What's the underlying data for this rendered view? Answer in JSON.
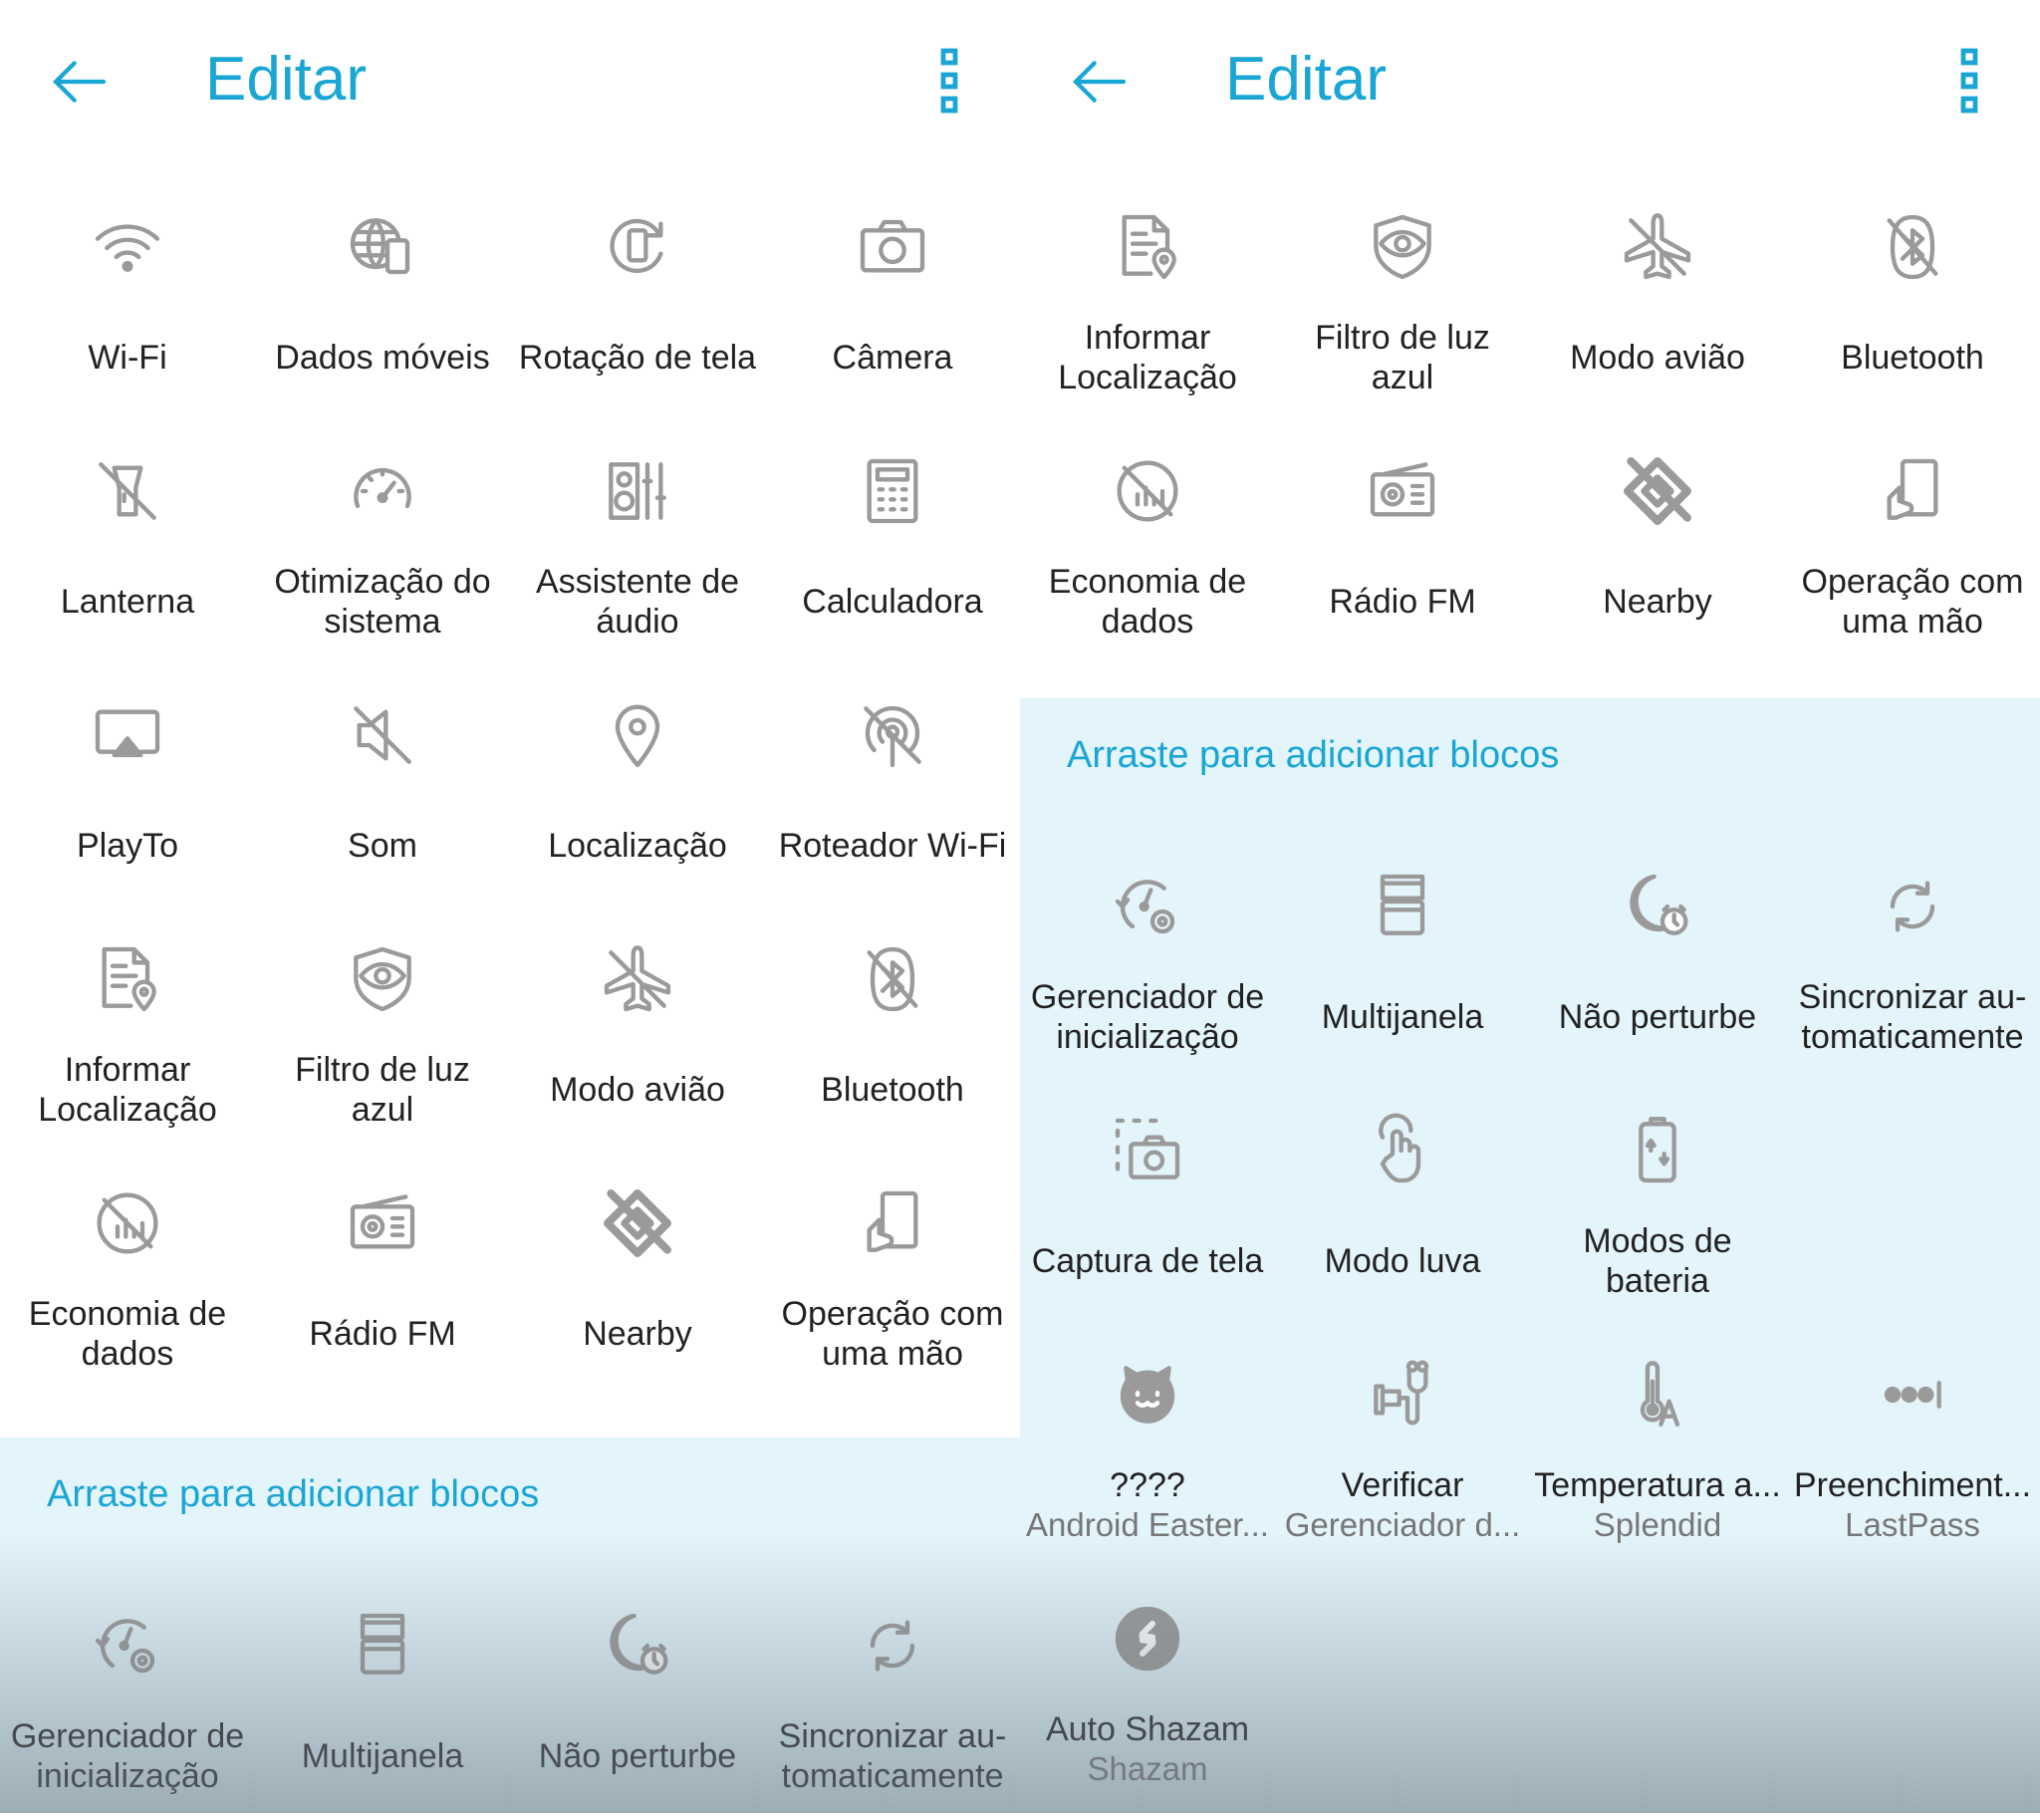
{
  "colors": {
    "accent": "#1aa6d4",
    "icon": "#9a9a9a",
    "drag_area": "#e3f4fb"
  },
  "left": {
    "header": {
      "title": "Editar",
      "back_icon": "arrow-left-icon",
      "menu_icon": "more-vert-icon"
    },
    "active_tiles": [
      {
        "label": "Wi-Fi",
        "icon": "wifi"
      },
      {
        "label": "Dados móveis",
        "icon": "globe-phone"
      },
      {
        "label": "Rotação de tela",
        "icon": "rotate"
      },
      {
        "label": "Câmera",
        "icon": "camera"
      },
      {
        "label": "Lanterna",
        "icon": "flashlight-off"
      },
      {
        "label": "Otimização do\nsistema",
        "icon": "speedometer"
      },
      {
        "label": "Assistente de\náudio",
        "icon": "audio"
      },
      {
        "label": "Calculadora",
        "icon": "calculator"
      },
      {
        "label": "PlayTo",
        "icon": "cast"
      },
      {
        "label": "Som",
        "icon": "sound-off"
      },
      {
        "label": "Localização",
        "icon": "location"
      },
      {
        "label": "Roteador Wi-Fi",
        "icon": "hotspot-off"
      },
      {
        "label": "Informar\nLocalização",
        "icon": "report-location"
      },
      {
        "label": "Filtro de luz\nazul",
        "icon": "eye-shield"
      },
      {
        "label": "Modo avião",
        "icon": "airplane"
      },
      {
        "label": "Bluetooth",
        "icon": "bluetooth-off"
      },
      {
        "label": "Economia de\ndados",
        "icon": "data-saver"
      },
      {
        "label": "Rádio FM",
        "icon": "radio"
      },
      {
        "label": "Nearby",
        "icon": "nearby"
      },
      {
        "label": "Operação com\numa mão",
        "icon": "one-hand"
      }
    ],
    "drag_header": "Arraste para adicionar blocos",
    "available_tiles": [
      {
        "label": "Gerenciador de\ninicialização",
        "icon": "startup"
      },
      {
        "label": "Multijanela",
        "icon": "multiwindow"
      },
      {
        "label": "Não perturbe",
        "icon": "moon-alarm"
      },
      {
        "label": "Sincronizar au-\ntomaticamente",
        "icon": "sync"
      }
    ]
  },
  "right": {
    "header": {
      "title": "Editar",
      "back_icon": "arrow-left-icon",
      "menu_icon": "more-vert-icon"
    },
    "active_tiles": [
      {
        "label": "Informar\nLocalização",
        "icon": "report-location"
      },
      {
        "label": "Filtro de luz\nazul",
        "icon": "eye-shield"
      },
      {
        "label": "Modo avião",
        "icon": "airplane"
      },
      {
        "label": "Bluetooth",
        "icon": "bluetooth-off"
      },
      {
        "label": "Economia de\ndados",
        "icon": "data-saver"
      },
      {
        "label": "Rádio FM",
        "icon": "radio"
      },
      {
        "label": "Nearby",
        "icon": "nearby"
      },
      {
        "label": "Operação com\numa mão",
        "icon": "one-hand"
      }
    ],
    "drag_header": "Arraste para adicionar blocos",
    "available_tiles": [
      {
        "label": "Gerenciador de\ninicialização",
        "icon": "startup"
      },
      {
        "label": "Multijanela",
        "icon": "multiwindow"
      },
      {
        "label": "Não perturbe",
        "icon": "moon-alarm"
      },
      {
        "label": "Sincronizar au-\ntomaticamente",
        "icon": "sync"
      },
      {
        "label": "Captura de tela",
        "icon": "screenshot"
      },
      {
        "label": "Modo luva",
        "icon": "glove"
      },
      {
        "label": "Modos de\nbateria",
        "icon": "battery"
      },
      null,
      {
        "label": "????",
        "sub": "Android Easter...",
        "icon": "cat"
      },
      {
        "label": "Verificar",
        "sub": "Gerenciador d...",
        "icon": "stethoscope"
      },
      {
        "label": "Temperatura a...",
        "sub": "Splendid",
        "icon": "thermometer"
      },
      {
        "label": "Preenchiment...",
        "sub": "LastPass",
        "icon": "lastpass"
      },
      {
        "label": "Auto Shazam",
        "sub": "Shazam",
        "icon": "shazam"
      }
    ]
  }
}
